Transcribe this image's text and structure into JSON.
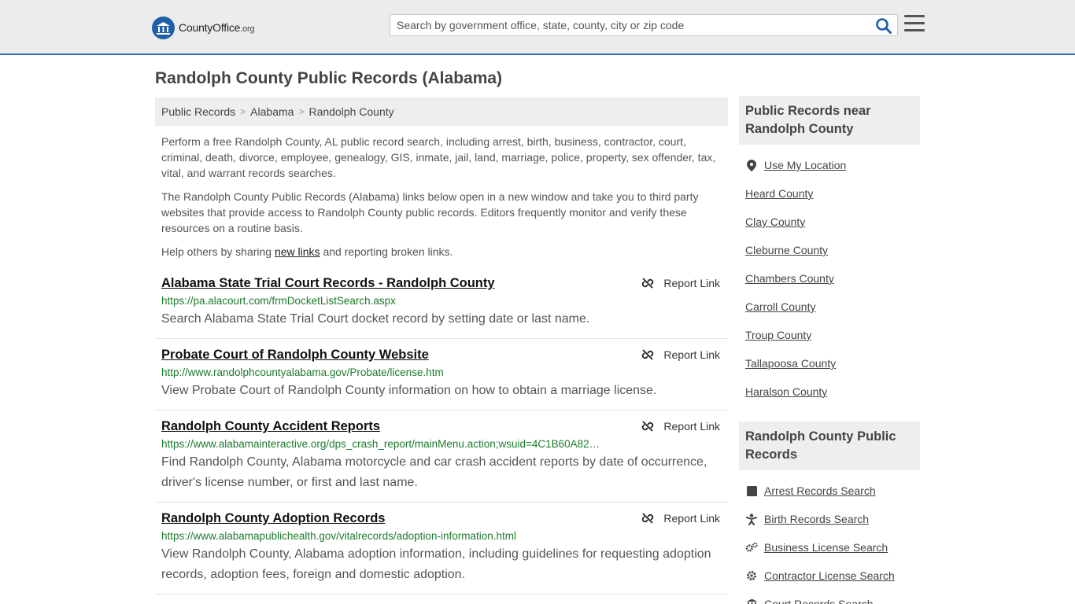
{
  "header": {
    "logo_text_main": "CountyOffice",
    "logo_text_suffix": ".org",
    "search_placeholder": "Search by government office, state, county, city or zip code"
  },
  "page": {
    "title": "Randolph County Public Records (Alabama)"
  },
  "breadcrumb": [
    "Public Records",
    "Alabama",
    "Randolph County"
  ],
  "intro": {
    "p1": "Perform a free Randolph County, AL public record search, including arrest, birth, business, contractor, court, criminal, death, divorce, employee, genealogy, GIS, inmate, jail, land, marriage, police, property, sex offender, tax, vital, and warrant records searches.",
    "p2": "The Randolph County Public Records (Alabama) links below open in a new window and take you to third party websites that provide access to Randolph County public records. Editors frequently monitor and verify these resources on a routine basis.",
    "p3_before": "Help others by sharing ",
    "p3_link": "new links",
    "p3_after": " and reporting broken links."
  },
  "report_label": "Report Link",
  "results": [
    {
      "title": "Alabama State Trial Court Records - Randolph County",
      "url": "https://pa.alacourt.com/frmDocketListSearch.aspx",
      "desc": "Search Alabama State Trial Court docket record by setting date or last name."
    },
    {
      "title": "Probate Court of Randolph County Website",
      "url": "http://www.randolphcountyalabama.gov/Probate/license.htm",
      "desc": "View Probate Court of Randolph County information on how to obtain a marriage license."
    },
    {
      "title": "Randolph County Accident Reports",
      "url": "https://www.alabamainteractive.org/dps_crash_report/mainMenu.action;wsuid=4C1B60A82…",
      "desc": "Find Randolph County, Alabama motorcycle and car crash accident reports by date of occurrence, driver's license number, or first and last name."
    },
    {
      "title": "Randolph County Adoption Records",
      "url": "https://www.alabamapublichealth.gov/vitalrecords/adoption-information.html",
      "desc": "View Randolph County, Alabama adoption information, including guidelines for requesting adoption records, adoption fees, foreign and domestic adoption."
    }
  ],
  "sidebar": {
    "nearby_heading": "Public Records near Randolph County",
    "use_location": "Use My Location",
    "nearby": [
      "Heard County",
      "Clay County",
      "Cleburne County",
      "Chambers County",
      "Carroll County",
      "Troup County",
      "Tallapoosa County",
      "Haralson County"
    ],
    "records_heading": "Randolph County Public Records",
    "records": [
      {
        "label": "Arrest Records Search",
        "icon": "square-icon"
      },
      {
        "label": "Birth Records Search",
        "icon": "baby-icon"
      },
      {
        "label": "Business License Search",
        "icon": "gears-icon"
      },
      {
        "label": "Contractor License Search",
        "icon": "gear-icon"
      },
      {
        "label": "Court Records Search",
        "icon": "courthouse-icon"
      }
    ]
  },
  "colors": {
    "accent": "#3a73b4",
    "url_green": "#1d7a2c",
    "logo_blue": "#1f5ea8"
  }
}
